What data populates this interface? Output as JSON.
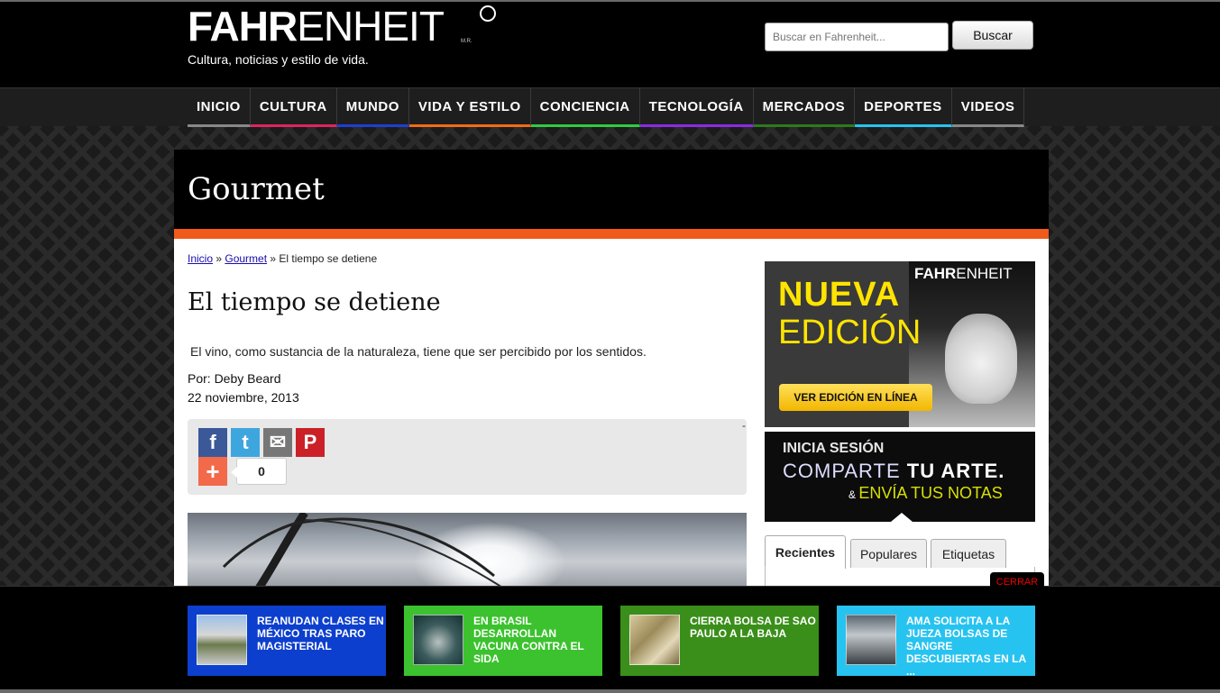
{
  "site": {
    "logo_bold": "FAHR",
    "logo_light": "ENHEIT",
    "logo_mark": "M.R.",
    "tagline": "Cultura, noticias y estilo de vida."
  },
  "search": {
    "placeholder": "Buscar en Fahrenheit...",
    "button_label": "Buscar"
  },
  "nav": {
    "items": [
      {
        "label": "INICIO",
        "color": "#888888"
      },
      {
        "label": "CULTURA",
        "color": "#e0245e"
      },
      {
        "label": "MUNDO",
        "color": "#1f3fd0"
      },
      {
        "label": "VIDA Y ESTILO",
        "color": "#f26a1a"
      },
      {
        "label": "CONCIENCIA",
        "color": "#2ecc40"
      },
      {
        "label": "TECNOLOGÍA",
        "color": "#8a2be2"
      },
      {
        "label": "MERCADOS",
        "color": "#2d7a1c"
      },
      {
        "label": "DEPORTES",
        "color": "#27c3f0"
      },
      {
        "label": "VIDEOS",
        "color": "#888888"
      }
    ]
  },
  "section": {
    "title": "Gourmet",
    "accent_color": "#f05a1a"
  },
  "breadcrumb": {
    "home": "Inicio",
    "sep1": " » ",
    "section": "Gourmet",
    "sep2": " » ",
    "current": "El tiempo se detiene"
  },
  "article": {
    "title": "El tiempo se detiene",
    "summary": "El vino, como sustancia de la naturaleza, tiene que ser percibido por los sentidos.",
    "author": "Por: Deby Beard",
    "date": "22 noviembre, 2013"
  },
  "share": {
    "facebook_icon": "f",
    "twitter_icon": "t",
    "email_icon": "✉",
    "pinterest_icon": "P",
    "plus_icon": "+",
    "count": "0",
    "dash": "-"
  },
  "sidebar": {
    "ad": {
      "mag_logo_bold": "FAHR",
      "mag_logo_light": "ENHEIT",
      "headline_1": "NUEVA",
      "headline_2": "EDICIÓN",
      "button_label": "VER EDICIÓN EN LÍNEA"
    },
    "promo": {
      "line1": "INICIA SESIÓN",
      "line2_a": "COMPARTE ",
      "line2_b": "TU ARTE.",
      "line3_amp": "& ",
      "line3": "ENVÍA TUS NOTAS"
    },
    "tabs": [
      {
        "label": "Recientes"
      },
      {
        "label": "Populares"
      },
      {
        "label": "Etiquetas"
      }
    ]
  },
  "bottom": {
    "close_label": "CERRAR",
    "cards": [
      {
        "text": "REANUDAN CLASES EN MÉXICO TRAS PARO MAGISTERIAL",
        "color": "#0d3fce"
      },
      {
        "text": "EN BRASIL DESARROLLAN VACUNA CONTRA EL SIDA",
        "color": "#3bc22e"
      },
      {
        "text": "CIERRA BOLSA DE SAO PAULO A LA BAJA",
        "color": "#3a8f1a"
      },
      {
        "text": "AMA SOLICITA A LA JUEZA BOLSAS DE SANGRE DESCUBIERTAS EN LA ...",
        "color": "#27c3f0"
      }
    ]
  }
}
